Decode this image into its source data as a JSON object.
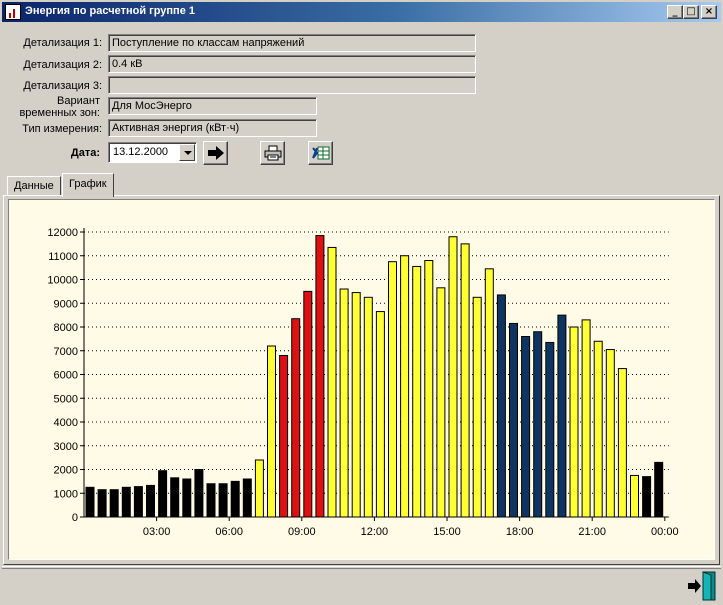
{
  "window": {
    "title": "Энергия по расчетной группе  1",
    "controls": {
      "minimize": "_",
      "maximize": "□",
      "close": "×"
    }
  },
  "form": {
    "detail1": {
      "label": "Детализация 1:",
      "value": "Поступление по классам напряжений"
    },
    "detail2": {
      "label": "Детализация 2:",
      "value": "0.4 кВ"
    },
    "detail3": {
      "label": "Детализация 3:",
      "value": ""
    },
    "zones": {
      "label_line1": "Вариант",
      "label_line2": "временных зон:",
      "value": "Для МосЭнерго"
    },
    "measure": {
      "label": "Тип измерения:",
      "value": "Активная энергия (кВт·ч)"
    },
    "date": {
      "label": "Дата:",
      "value": "13.12.2000"
    }
  },
  "toolbar": {
    "go_icon": "arrow-right-icon",
    "print_icon": "printer-icon",
    "excel_icon": "excel-icon"
  },
  "tabs": [
    {
      "label": "Данные",
      "active": false
    },
    {
      "label": "График",
      "active": true
    }
  ],
  "colors": {
    "black": "#000000",
    "yellow": "#ffff33",
    "red": "#dd1111",
    "blue": "#0f3462",
    "chart_bg": "#fffbe6"
  },
  "chart_data": {
    "type": "bar",
    "ylim": [
      0,
      12000
    ],
    "yticks": [
      "0",
      "1000",
      "2000",
      "3000",
      "4000",
      "5000",
      "6000",
      "7000",
      "8000",
      "9000",
      "10000",
      "11000",
      "12000"
    ],
    "xtick_labels": [
      {
        "label": "03:00",
        "after_bar": 6
      },
      {
        "label": "06:00",
        "after_bar": 12
      },
      {
        "label": "09:00",
        "after_bar": 18
      },
      {
        "label": "12:00",
        "after_bar": 24
      },
      {
        "label": "15:00",
        "after_bar": 30
      },
      {
        "label": "18:00",
        "after_bar": 36
      },
      {
        "label": "21:00",
        "after_bar": 42
      },
      {
        "label": "00:00",
        "after_bar": 48
      }
    ],
    "grid": "horizontal-dotted",
    "legend": "none",
    "bars": [
      {
        "v": 1250,
        "zone": "black"
      },
      {
        "v": 1150,
        "zone": "black"
      },
      {
        "v": 1150,
        "zone": "black"
      },
      {
        "v": 1250,
        "zone": "black"
      },
      {
        "v": 1280,
        "zone": "black"
      },
      {
        "v": 1330,
        "zone": "black"
      },
      {
        "v": 1950,
        "zone": "black"
      },
      {
        "v": 1650,
        "zone": "black"
      },
      {
        "v": 1600,
        "zone": "black"
      },
      {
        "v": 2000,
        "zone": "black"
      },
      {
        "v": 1400,
        "zone": "black"
      },
      {
        "v": 1400,
        "zone": "black"
      },
      {
        "v": 1500,
        "zone": "black"
      },
      {
        "v": 1600,
        "zone": "black"
      },
      {
        "v": 2400,
        "zone": "yellow"
      },
      {
        "v": 7200,
        "zone": "yellow"
      },
      {
        "v": 6800,
        "zone": "red"
      },
      {
        "v": 8350,
        "zone": "red"
      },
      {
        "v": 9500,
        "zone": "red"
      },
      {
        "v": 11850,
        "zone": "red"
      },
      {
        "v": 11350,
        "zone": "yellow"
      },
      {
        "v": 9600,
        "zone": "yellow"
      },
      {
        "v": 9450,
        "zone": "yellow"
      },
      {
        "v": 9250,
        "zone": "yellow"
      },
      {
        "v": 8650,
        "zone": "yellow"
      },
      {
        "v": 10750,
        "zone": "yellow"
      },
      {
        "v": 11000,
        "zone": "yellow"
      },
      {
        "v": 10550,
        "zone": "yellow"
      },
      {
        "v": 10800,
        "zone": "yellow"
      },
      {
        "v": 9650,
        "zone": "yellow"
      },
      {
        "v": 11800,
        "zone": "yellow"
      },
      {
        "v": 11500,
        "zone": "yellow"
      },
      {
        "v": 9250,
        "zone": "yellow"
      },
      {
        "v": 10450,
        "zone": "yellow"
      },
      {
        "v": 9350,
        "zone": "blue"
      },
      {
        "v": 8150,
        "zone": "blue"
      },
      {
        "v": 7600,
        "zone": "blue"
      },
      {
        "v": 7800,
        "zone": "blue"
      },
      {
        "v": 7350,
        "zone": "blue"
      },
      {
        "v": 8500,
        "zone": "blue"
      },
      {
        "v": 8000,
        "zone": "yellow"
      },
      {
        "v": 8300,
        "zone": "yellow"
      },
      {
        "v": 7400,
        "zone": "yellow"
      },
      {
        "v": 7050,
        "zone": "yellow"
      },
      {
        "v": 6250,
        "zone": "yellow"
      },
      {
        "v": 1750,
        "zone": "yellow"
      },
      {
        "v": 1700,
        "zone": "black"
      },
      {
        "v": 2300,
        "zone": "black"
      }
    ]
  },
  "statusbar": {
    "exit_icon": "exit-door-icon"
  }
}
